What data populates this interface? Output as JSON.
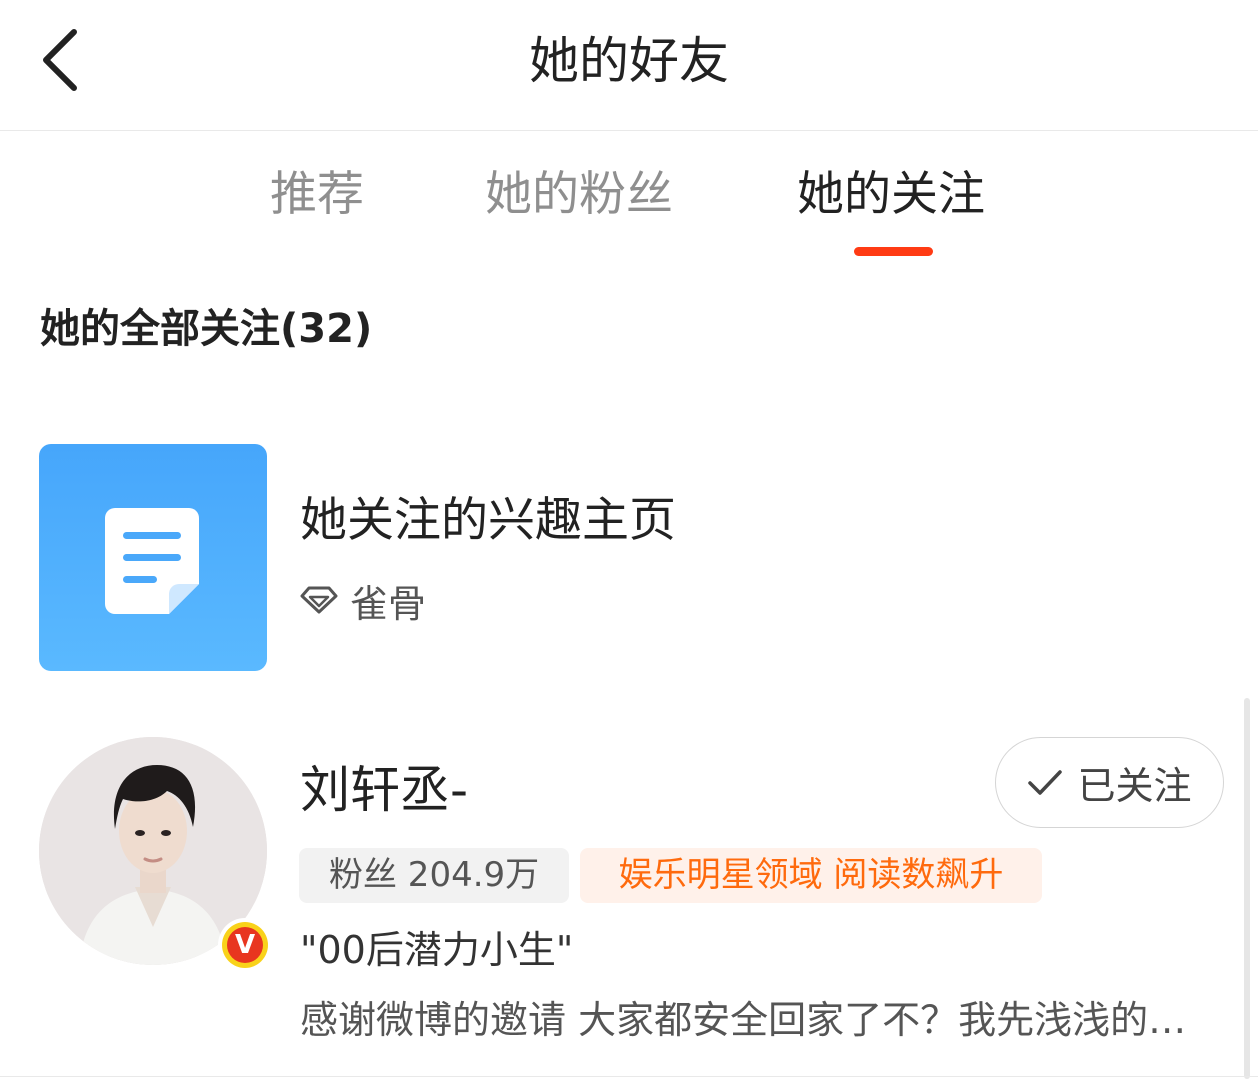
{
  "header": {
    "title": "她的好友",
    "back_icon": "chevron-left-icon"
  },
  "tabs": [
    {
      "label": "推荐",
      "active": false
    },
    {
      "label": "她的粉丝",
      "active": false
    },
    {
      "label": "她的关注",
      "active": true
    }
  ],
  "colors": {
    "accent": "#ff3b14",
    "interest_blue": "#4aaaf9",
    "hot_tag_text": "#ff6a0d",
    "hot_tag_bg": "#fff1ea"
  },
  "section": {
    "title": "她的全部关注(32)"
  },
  "interest": {
    "title": "她关注的兴趣主页",
    "sub_icon": "diamond-icon",
    "sub_text": "雀骨",
    "thumb_icon": "document-icon"
  },
  "user": {
    "name": "刘轩丞-",
    "follow_icon": "checkmark-icon",
    "follow_label": "已关注",
    "fans": "粉丝 204.9万",
    "hot_tag": "娱乐明星领域 阅读数飙升",
    "desc": "\"00后潜力小生\"",
    "post": "感谢微博的邀请 大家都安全回家了不？我先浅浅的…",
    "verified": true,
    "verified_icon": "verified-v-badge-icon"
  }
}
